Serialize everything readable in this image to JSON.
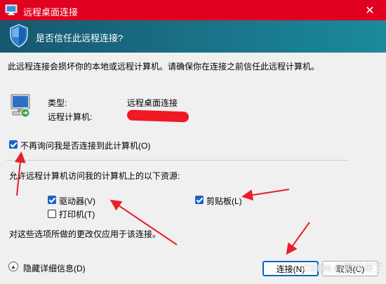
{
  "window": {
    "title": "远程桌面连接",
    "close_glyph": "✕"
  },
  "banner": {
    "heading": "是否信任此远程连接?"
  },
  "message": "此远程连接会损坏你的本地或远程计算机。请确保你在连接之前信任此远程计算机。",
  "details": {
    "type_label": "类型:",
    "type_value": "远程桌面连接",
    "remote_label": "远程计算机:"
  },
  "dont_ask": {
    "label": "不再询问我是否连接到此计算机(O)",
    "checked": true
  },
  "resources": {
    "heading": "允许远程计算机访问我的计算机上的以下资源:",
    "drives": {
      "label": "驱动器(V)",
      "checked": true
    },
    "clipboard": {
      "label": "剪贴板(L)",
      "checked": true
    },
    "printers": {
      "label": "打印机(T)",
      "checked": false
    }
  },
  "note": "对这些选项所做的更改仅应用于该连接。",
  "footer": {
    "details_toggle": "隐藏详细信息(D)",
    "connect": "连接(N)",
    "cancel": "取消(C)"
  },
  "watermark": "CSDN @笑笑布丁",
  "colors": {
    "titlebar": "#e0001f",
    "banner": "#1a7388",
    "accent": "#1a64c8",
    "annotation": "#e8202a"
  }
}
